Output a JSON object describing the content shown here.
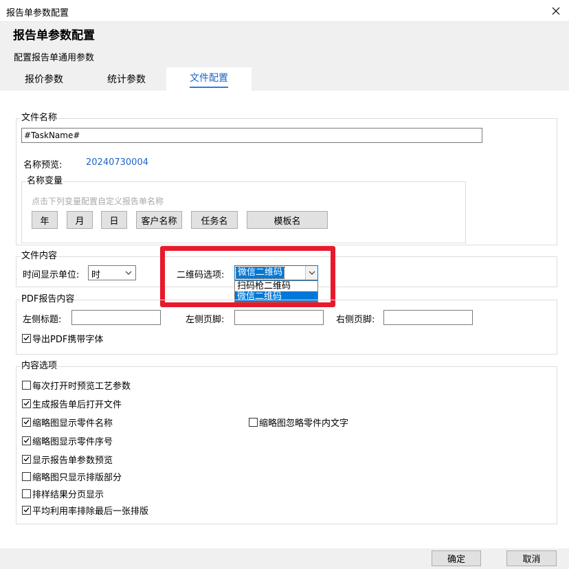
{
  "window": {
    "title": "报告单参数配置",
    "close_icon": "close-icon"
  },
  "header": {
    "title": "报告单参数配置",
    "subtitle": "配置报告单通用参数"
  },
  "tabs": [
    {
      "label": "报价参数",
      "active": false
    },
    {
      "label": "统计参数",
      "active": false
    },
    {
      "label": "文件配置",
      "active": true
    }
  ],
  "file_name": {
    "group_title": "文件名称",
    "value": "#TaskName#",
    "preview_label": "名称预览:",
    "preview_value": "20240730004",
    "preview_color": "#1e64c8",
    "vars": {
      "group_title": "名称变量",
      "hint": "点击下列变量配置自定义报告单名称",
      "buttons": [
        "年",
        "月",
        "日",
        "客户名称",
        "任务名",
        "模板名"
      ]
    }
  },
  "file_content": {
    "group_title": "文件内容",
    "time_unit_label": "时间显示单位:",
    "time_unit_value": "时",
    "qr_label": "二维码选项:",
    "qr_value": "微信二维码",
    "qr_options": [
      "扫码枪二维码",
      "微信二维码"
    ],
    "qr_selected_index": 1,
    "highlight_color": "#e8192c",
    "selection_color": "#0078d7"
  },
  "pdf": {
    "group_title": "PDF报告内容",
    "left_title_label": "左侧标题:",
    "left_title_value": "",
    "left_footer_label": "左侧页脚:",
    "left_footer_value": "",
    "right_footer_label": "右侧页脚:",
    "right_footer_value": "",
    "embed_font": {
      "label": "导出PDF携带字体",
      "checked": true
    }
  },
  "content_options": {
    "group_title": "内容选项",
    "items": [
      {
        "label": "每次打开时预览工艺参数",
        "checked": false
      },
      {
        "label": "生成报告单后打开文件",
        "checked": true
      },
      {
        "label": "缩略图显示零件名称",
        "checked": true
      },
      {
        "label": "缩略图忽略零件内文字",
        "checked": false
      },
      {
        "label": "缩略图显示零件序号",
        "checked": true
      },
      {
        "label": "显示报告单参数预览",
        "checked": true
      },
      {
        "label": "缩略图只显示排版部分",
        "checked": false
      },
      {
        "label": "排样结果分页显示",
        "checked": false
      },
      {
        "label": "平均利用率排除最后一张排版",
        "checked": true
      }
    ]
  },
  "footer": {
    "ok_label": "确定",
    "cancel_label": "取消"
  }
}
